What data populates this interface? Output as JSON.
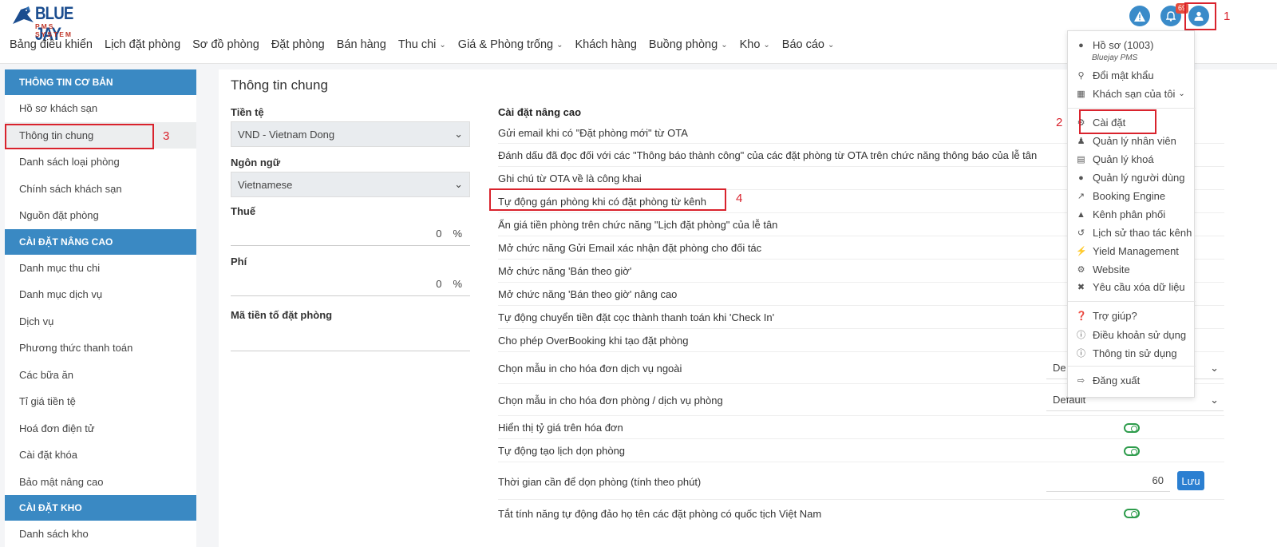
{
  "brand": {
    "name": "BLUE JAY",
    "tagline": "PMS SYSTEM"
  },
  "nav": [
    {
      "label": "Bảng điều khiển",
      "has_menu": false
    },
    {
      "label": "Lịch đặt phòng",
      "has_menu": false
    },
    {
      "label": "Sơ đồ phòng",
      "has_menu": false
    },
    {
      "label": "Đặt phòng",
      "has_menu": false
    },
    {
      "label": "Bán hàng",
      "has_menu": false
    },
    {
      "label": "Thu chi",
      "has_menu": true
    },
    {
      "label": "Giá & Phòng trống",
      "has_menu": true
    },
    {
      "label": "Khách hàng",
      "has_menu": false
    },
    {
      "label": "Buồng phòng",
      "has_menu": true
    },
    {
      "label": "Kho",
      "has_menu": true
    },
    {
      "label": "Báo cáo",
      "has_menu": true
    }
  ],
  "header_icons": {
    "notification_count": "69"
  },
  "annotations": {
    "n1": "1",
    "n2": "2",
    "n3": "3",
    "n4": "4"
  },
  "sidebar": {
    "sections": [
      {
        "title": "THÔNG TIN CƠ BẢN",
        "items": [
          "Hồ sơ khách sạn",
          "Thông tin chung",
          "Danh sách loại phòng",
          "Chính sách khách sạn",
          "Nguồn đặt phòng"
        ]
      },
      {
        "title": "CÀI ĐẶT NÂNG CAO",
        "items": [
          "Danh mục thu chi",
          "Danh mục dịch vụ",
          "Dịch vụ",
          "Phương thức thanh toán",
          "Các bữa ăn",
          "Tỉ giá tiền tệ",
          "Hoá đơn điện tử",
          "Cài đặt khóa",
          "Bảo mật nâng cao"
        ]
      },
      {
        "title": "CÀI ĐẶT KHO",
        "items": [
          "Danh sách kho"
        ]
      }
    ],
    "active_item": "Thông tin chung"
  },
  "main": {
    "title": "Thông tin chung",
    "currency_label": "Tiền tệ",
    "currency_value": "VND - Vietnam Dong",
    "language_label": "Ngôn ngữ",
    "language_value": "Vietnamese",
    "tax_label": "Thuế",
    "tax_value": "0",
    "tax_unit": "%",
    "fee_label": "Phí",
    "fee_value": "0",
    "fee_unit": "%",
    "prefix_label": "Mã tiền tố đặt phòng",
    "advanced_title": "Cài đặt nâng cao",
    "advanced_rows": [
      "Gửi email khi có \"Đặt phòng mới\" từ OTA",
      "Đánh dấu đã đọc đối với các \"Thông báo thành công\" của các đặt phòng từ OTA trên chức năng thông báo của lễ tân",
      "Ghi chú từ OTA về là công khai",
      "Tự động gán phòng khi có đặt phòng từ kênh",
      "Ẩn giá tiền phòng trên chức năng \"Lịch đặt phòng\" của lễ tân",
      "Mở chức năng Gửi Email xác nhận đặt phòng cho đối tác",
      "Mở chức năng 'Bán theo giờ'",
      "Mở chức năng 'Bán theo giờ' nâng cao",
      "Tự động chuyển tiền đặt cọc thành thanh toán khi 'Check In'",
      "Cho phép OverBooking khi tạo đặt phòng"
    ],
    "service_invoice_label": "Chọn mẫu in cho hóa đơn dịch vụ ngoài",
    "service_invoice_value": "De",
    "room_invoice_label": "Chọn mẫu in cho hóa đơn phòng / dịch vụ phòng",
    "room_invoice_value": "Default",
    "exchange_rate_label": "Hiển thị tỷ giá trên hóa đơn",
    "auto_cleaning_label": "Tự động tạo lịch dọn phòng",
    "cleaning_time_label": "Thời gian cần để dọn phòng (tính theo phút)",
    "cleaning_time_value": "60",
    "save_label": "Lưu",
    "name_swap_label": "Tắt tính năng tự động đảo họ tên các đặt phòng có quốc tịch Việt Nam"
  },
  "user_menu": {
    "profile": "Hồ sơ  (1003)",
    "profile_sub": "Bluejay PMS",
    "change_password": "Đổi mật khẩu",
    "my_hotels": "Khách sạn của tôi",
    "settings": "Cài đặt",
    "staff": "Quản lý nhân viên",
    "locks": "Quản lý khoá",
    "users": "Quản lý người dùng",
    "booking_engine": "Booking Engine",
    "channel": "Kênh phân phối",
    "channel_history": "Lịch sử thao tác kênh",
    "yield": "Yield Management",
    "website": "Website",
    "delete_request": "Yêu cầu xóa dữ liệu",
    "help": "Trợ giúp?",
    "terms": "Điều khoản sử dụng",
    "usage_info": "Thông tin sử dụng",
    "logout": "Đăng xuất"
  },
  "colors": {
    "primary": "#3a89c3",
    "annotation": "#d9232d",
    "toggle": "#2e9c4c",
    "button": "#2b7fd1"
  }
}
